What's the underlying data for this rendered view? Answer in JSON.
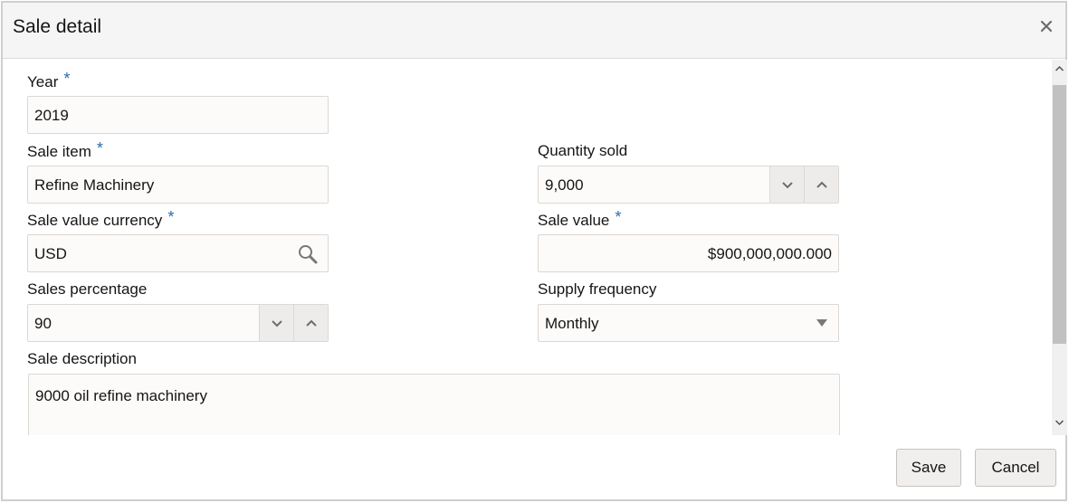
{
  "dialog": {
    "title": "Sale detail",
    "close_icon": "close-icon"
  },
  "form": {
    "year": {
      "label": "Year",
      "required": "*",
      "value": "2019"
    },
    "sale_item": {
      "label": "Sale item",
      "required": "*",
      "value": "Refine Machinery"
    },
    "quantity_sold": {
      "label": "Quantity sold",
      "value": "9,000"
    },
    "sale_value_currency": {
      "label": "Sale value currency",
      "required": "*",
      "value": "USD",
      "icon": "search-icon"
    },
    "sale_value": {
      "label": "Sale value",
      "required": "*",
      "value": "$900,000,000.000"
    },
    "sales_percentage": {
      "label": "Sales percentage",
      "value": "90"
    },
    "supply_frequency": {
      "label": "Supply frequency",
      "value": "Monthly"
    },
    "sale_description": {
      "label": "Sale description",
      "value": "9000 oil refine machinery"
    }
  },
  "footer": {
    "save_label": "Save",
    "cancel_label": "Cancel"
  },
  "colors": {
    "required_asterisk": "#2b6cb0",
    "header_bg": "#f5f5f5",
    "field_bg": "#fcfbfa"
  }
}
